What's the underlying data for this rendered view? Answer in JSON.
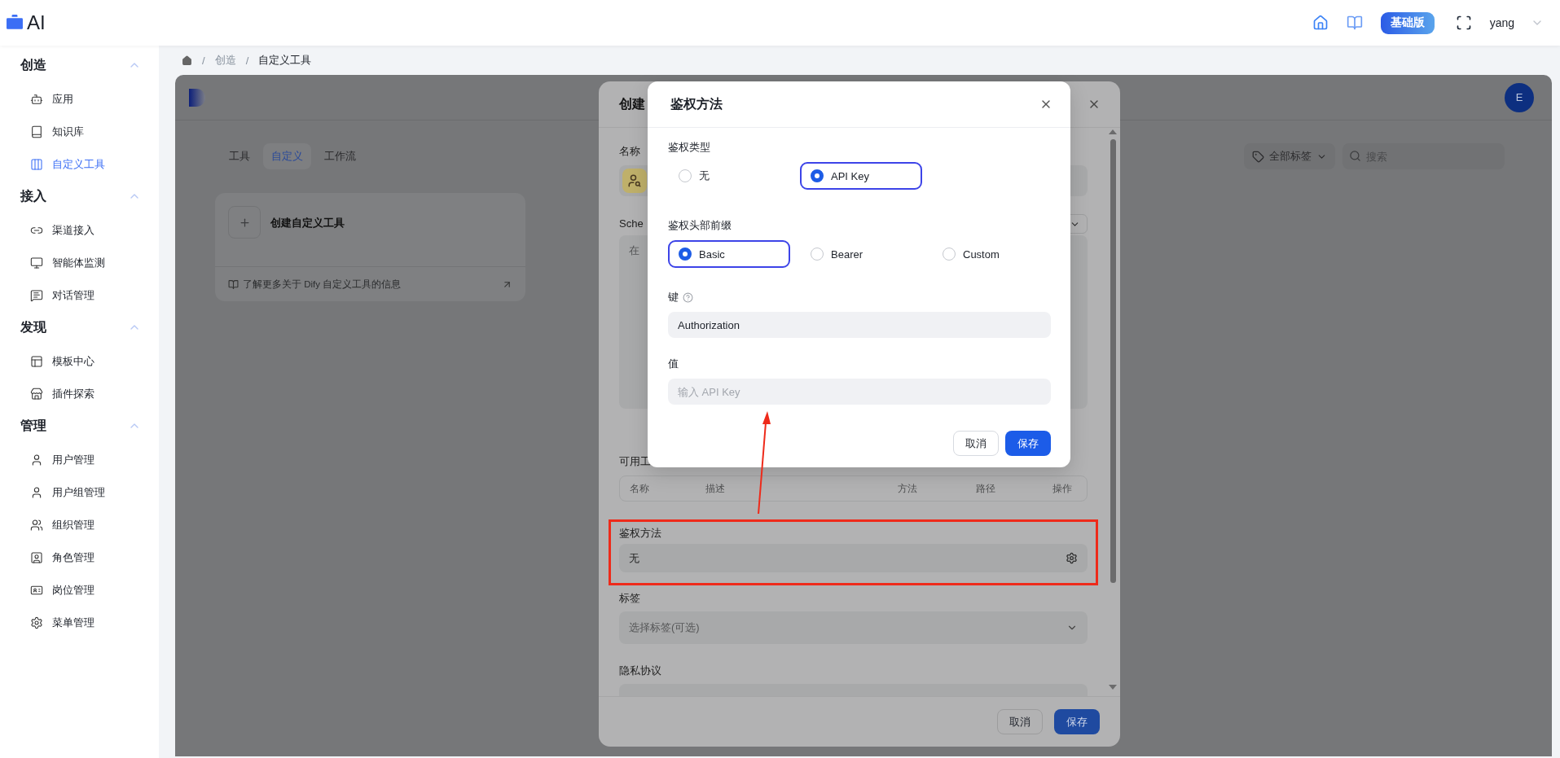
{
  "header": {
    "logo_text": "AI",
    "plan_badge": "基础版",
    "user": "yang"
  },
  "sidebar": {
    "sections": [
      {
        "title": "创造",
        "expanded": true,
        "items": [
          {
            "label": "应用",
            "selected": false
          },
          {
            "label": "知识库",
            "selected": false
          },
          {
            "label": "自定义工具",
            "selected": true
          }
        ]
      },
      {
        "title": "接入",
        "expanded": true,
        "items": [
          {
            "label": "渠道接入",
            "selected": false
          },
          {
            "label": "智能体监测",
            "selected": false
          },
          {
            "label": "对话管理",
            "selected": false
          }
        ]
      },
      {
        "title": "发现",
        "expanded": true,
        "items": [
          {
            "label": "模板中心",
            "selected": false
          },
          {
            "label": "插件探索",
            "selected": false
          }
        ]
      },
      {
        "title": "管理",
        "expanded": true,
        "items": [
          {
            "label": "用户管理",
            "selected": false
          },
          {
            "label": "用户组管理",
            "selected": false
          },
          {
            "label": "组织管理",
            "selected": false
          },
          {
            "label": "角色管理",
            "selected": false
          },
          {
            "label": "岗位管理",
            "selected": false
          },
          {
            "label": "菜单管理",
            "selected": false
          }
        ]
      }
    ]
  },
  "breadcrumb": [
    "/",
    "创造",
    "/",
    "自定义工具"
  ],
  "tool_page": {
    "avatar": "E",
    "tabs": [
      {
        "label": "工具",
        "selected": false
      },
      {
        "label": "自定义",
        "selected": true
      },
      {
        "label": "工作流",
        "selected": false
      }
    ],
    "tag_filter": "全部标签",
    "search": {
      "placeholder": "搜索"
    },
    "create_card": {
      "title": "创建自定义工具",
      "link": "了解更多关于 Dify 自定义工具的信息"
    }
  },
  "create_dialog": {
    "title": "创建",
    "name_label": "名称",
    "schema_label": "Sche",
    "schema_placeholder": "在",
    "tools_label": "可用工",
    "tool_columns": [
      "名称",
      "描述",
      "方法",
      "路径",
      "操作"
    ],
    "auth_label": "鉴权方法",
    "auth_value": "无",
    "tags_label": "标签",
    "tags_placeholder": "选择标签(可选)",
    "privacy_label": "隐私协议",
    "buttons": [
      "取消",
      "保存"
    ]
  },
  "auth_dialog": {
    "title": "鉴权方法",
    "auth_type_label": "鉴权类型",
    "auth_types": [
      {
        "label": "无",
        "selected": false
      },
      {
        "label": "API Key",
        "selected": true
      }
    ],
    "prefix_label": "鉴权头部前缀",
    "prefixes": [
      {
        "label": "Basic",
        "selected": true
      },
      {
        "label": "Bearer",
        "selected": false
      },
      {
        "label": "Custom",
        "selected": false
      }
    ],
    "key_label": "键",
    "key_value": "Authorization",
    "value_label": "值",
    "value_placeholder": "输入 API Key",
    "buttons": [
      "取消",
      "保存"
    ]
  }
}
